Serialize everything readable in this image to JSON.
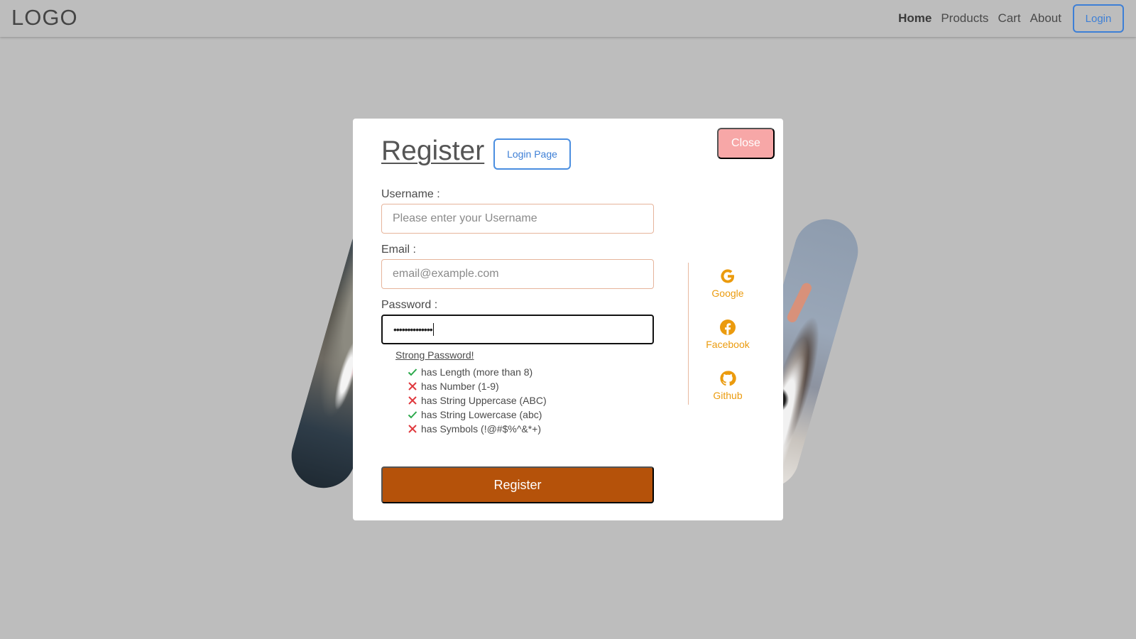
{
  "navbar": {
    "logo": "LOGO",
    "links": [
      {
        "label": "Home",
        "active": true
      },
      {
        "label": "Products",
        "active": false
      },
      {
        "label": "Cart",
        "active": false
      },
      {
        "label": "About",
        "active": false
      }
    ],
    "login_label": "Login"
  },
  "modal": {
    "title": "Register",
    "login_page_label": "Login Page",
    "close_label": "Close",
    "username": {
      "label": "Username :",
      "placeholder": "Please enter your Username",
      "value": ""
    },
    "email": {
      "label": "Email :",
      "placeholder": "email@example.com",
      "value": ""
    },
    "password": {
      "label": "Password :",
      "masked_value": "••••••••••••••"
    },
    "strength_link": "Strong Password!",
    "rules": [
      {
        "text": "has Length (more than 8)",
        "passed": true
      },
      {
        "text": "has Number (1-9)",
        "passed": false
      },
      {
        "text": "has String Uppercase (ABC)",
        "passed": false
      },
      {
        "text": "has String Lowercase (abc)",
        "passed": true
      },
      {
        "text": "has Symbols (!@#$%^&*+)",
        "passed": false
      }
    ],
    "register_label": "Register",
    "social": [
      {
        "label": "Google",
        "icon": "google-icon"
      },
      {
        "label": "Facebook",
        "icon": "facebook-icon"
      },
      {
        "label": "Github",
        "icon": "github-icon"
      }
    ]
  },
  "colors": {
    "background": "#bdbdbd",
    "accent_blue": "#3d7fd6",
    "close_pink": "#f7a7a7",
    "register_orange": "#b5520a",
    "social_orange": "#eb9b0e",
    "pass_green": "#2aa84a",
    "fail_red": "#e0393e"
  }
}
